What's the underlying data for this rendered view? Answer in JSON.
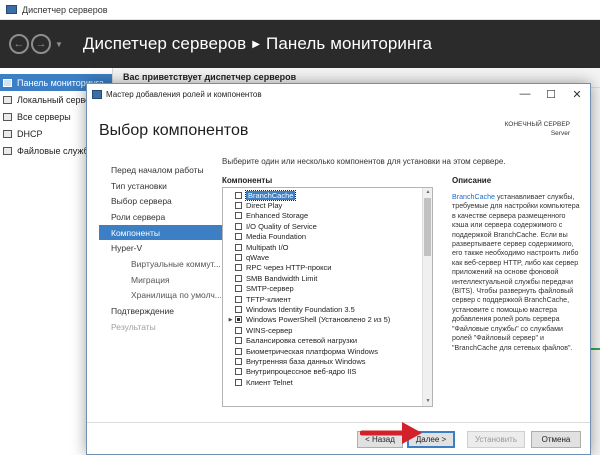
{
  "server_manager": {
    "window_title": "Диспетчер серверов",
    "header": {
      "title_app": "Диспетчер серверов",
      "title_page": "Панель мониторинга"
    },
    "sidebar": {
      "items": [
        {
          "label": "Панель мониторинга",
          "active": true
        },
        {
          "label": "Локальный сервер"
        },
        {
          "label": "Все серверы"
        },
        {
          "label": "DHCP"
        },
        {
          "label": "Файловые службы"
        }
      ]
    },
    "main": {
      "welcome": "Вас приветствует диспетчер серверов"
    }
  },
  "wizard": {
    "title": "Мастер добавления ролей и компонентов",
    "heading": "Выбор компонентов",
    "destination_label": "КОНЕЧНЫЙ СЕРВЕР",
    "destination_server": "Server",
    "steps": [
      "Перед началом работы",
      "Тип установки",
      "Выбор сервера",
      "Роли сервера",
      "Компоненты",
      "Hyper-V",
      "Виртуальные коммут...",
      "Миграция",
      "Хранилища по умолч...",
      "Подтверждение",
      "Результаты"
    ],
    "instruction": "Выберите один или несколько компонентов для установки на этом сервере.",
    "components_header": "Компоненты",
    "description_header": "Описание",
    "components": [
      "BranchCache",
      "Direct Play",
      "Enhanced Storage",
      "I/O Quality of Service",
      "Media Foundation",
      "Multipath I/O",
      "qWave",
      "RPC через HTTP-прокси",
      "SMB Bandwidth Limit",
      "SMTP-сервер",
      "TFTP-клиент",
      "Windows Identity Foundation 3.5",
      "Windows PowerShell (Установлено 2 из 5)",
      "WINS-сервер",
      "Балансировка сетевой нагрузки",
      "Биометрическая платформа Windows",
      "Внутренняя база данных Windows",
      "Внутрипроцессное веб-ядро IIS",
      "Клиент Telnet"
    ],
    "description_lead": "BranchCache",
    "description_body": " устанавливает службы, требуемые для настройки компьютера в качестве сервера размещенного кэша или сервера содержимого с поддержкой BranchCache. Если вы развертываете сервер содержимого, его также необходимо настроить либо как веб-сервер HTTP, либо как сервер приложений на основе фоновой интеллектуальной службы передачи (BITS). Чтобы развернуть файловый сервер с поддержкой BranchCache, установите с помощью мастера добавления ролей роль сервера \"Файловые службы\" со службами ролей \"Файловый сервер\" и \"BranchCache для сетевых файлов\".",
    "buttons": {
      "prev": "< Назад",
      "next": "Далее >",
      "install": "Установить",
      "cancel": "Отмена"
    },
    "window_controls": {
      "minimize": "—",
      "maximize": "☐",
      "close": "✕"
    }
  },
  "colors": {
    "accent": "#3c7fc4",
    "annotation_arrow": "#d3202a",
    "header_bg": "#2b2b2b"
  }
}
